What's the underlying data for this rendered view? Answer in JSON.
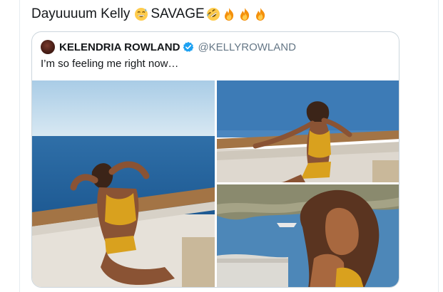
{
  "tweet": {
    "text": "Dayuuuum Kelly",
    "emoji_1": "grinning-sweat-emoji",
    "text_2": "SAVAGE",
    "emoji_2": "rofl-emoji",
    "emoji_fire": "fire-emoji"
  },
  "quoted_tweet": {
    "display_name": "KELENDRIA ROWLAND",
    "handle": "@KELLYROWLAND",
    "verified": true,
    "text": "I’m so feeling me right now…",
    "media_count": 3
  },
  "colors": {
    "text": "#14171a",
    "secondary_text": "#657786",
    "border": "#ccd6dd",
    "verified_blue": "#1da1f2",
    "swimsuit_yellow": "#d9a11e"
  }
}
